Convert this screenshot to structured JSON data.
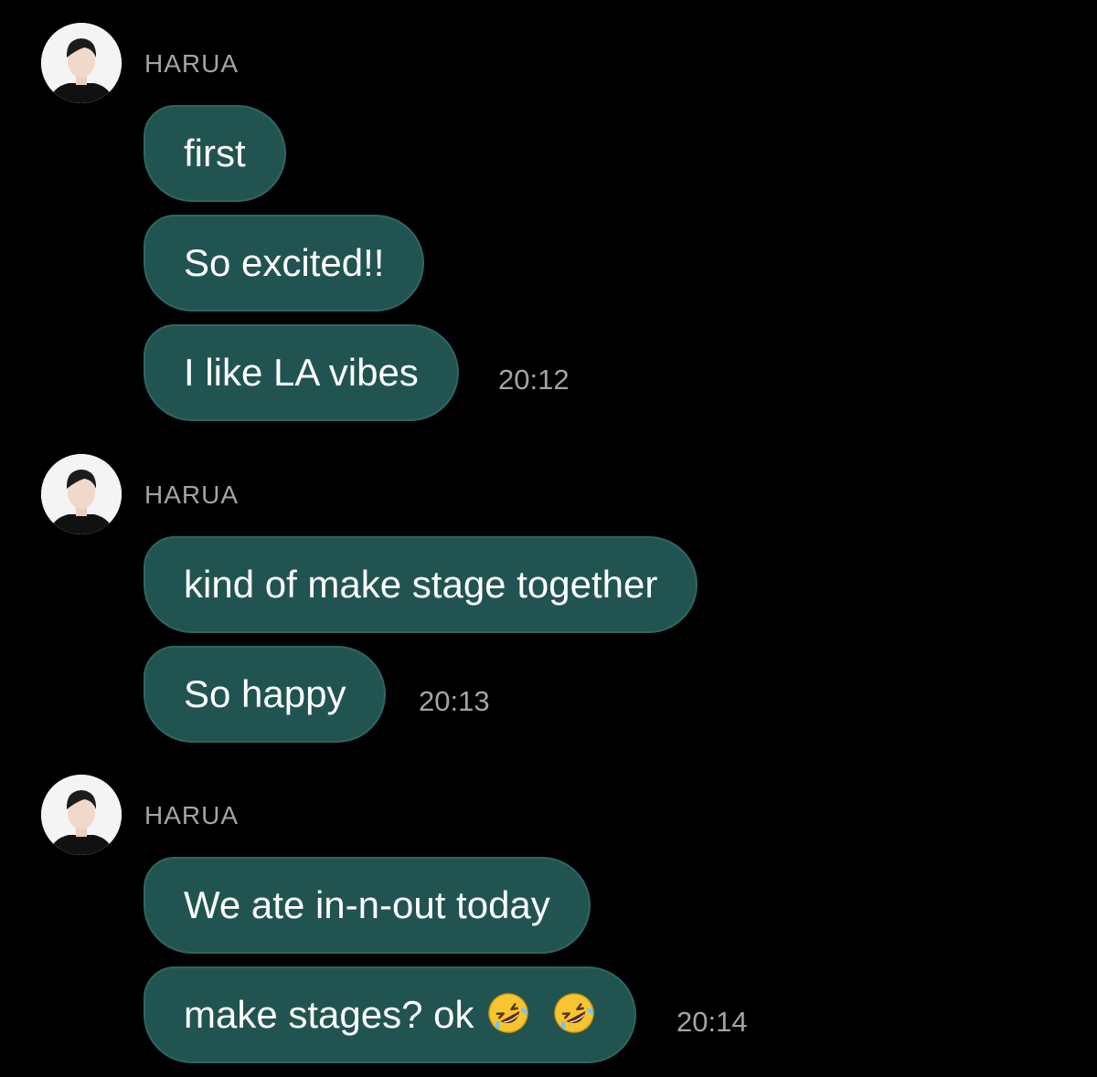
{
  "messages": {
    "groups": [
      {
        "sender": "HARUA",
        "bubbles": [
          "first",
          "So excited!!",
          "I like LA vibes"
        ],
        "time": "20:12"
      },
      {
        "sender": "HARUA",
        "bubbles": [
          "kind of make stage together",
          "So happy"
        ],
        "time": "20:13"
      },
      {
        "sender": "HARUA",
        "bubbles": [
          "We ate in-n-out today",
          "make stages? ok"
        ],
        "emoji": "rolling-on-the-floor-laughing-icon",
        "time": "20:14"
      }
    ]
  },
  "colors": {
    "background": "#000000",
    "bubble": "#215451",
    "bubble_text": "#ffffff",
    "meta_text": "#a4a4a4"
  }
}
